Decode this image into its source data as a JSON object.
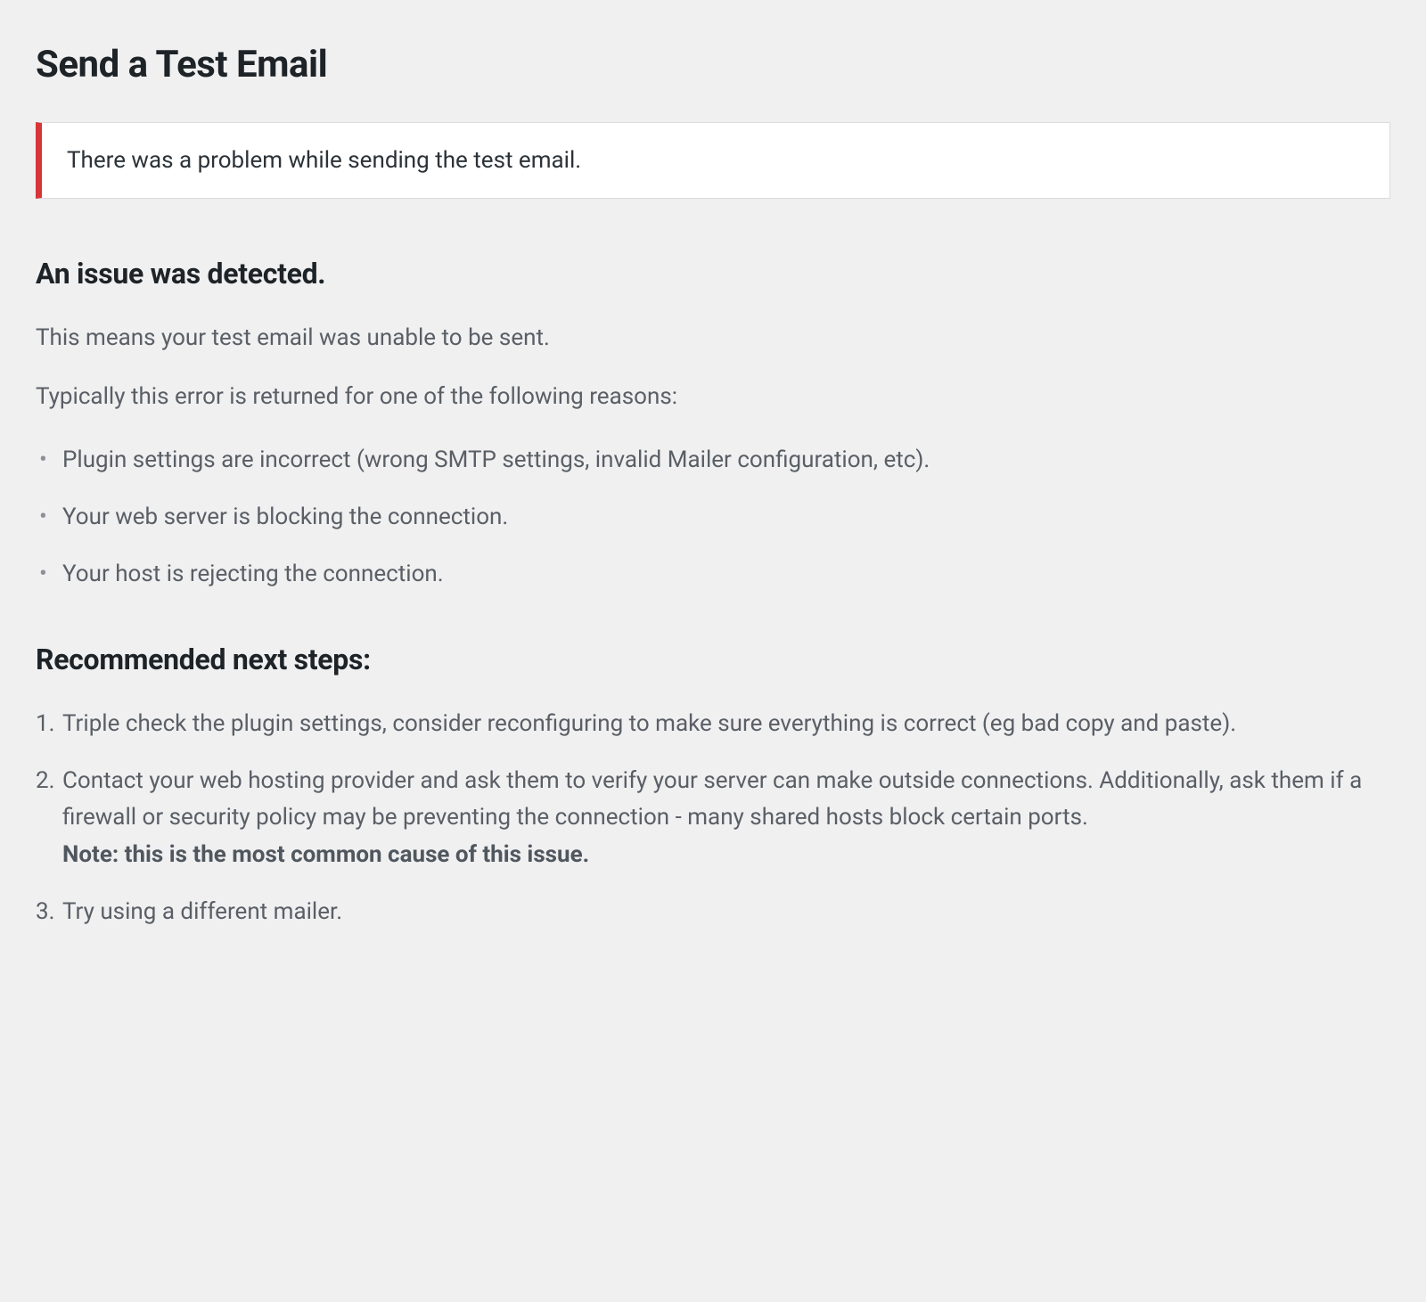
{
  "page": {
    "title": "Send a Test Email"
  },
  "error_banner": {
    "message": "There was a problem while sending the test email."
  },
  "issue": {
    "heading": "An issue was detected.",
    "intro": "This means your test email was unable to be sent.",
    "reasons_intro": "Typically this error is returned for one of the following reasons:",
    "reasons": [
      "Plugin settings are incorrect (wrong SMTP settings, invalid Mailer configuration, etc).",
      "Your web server is blocking the connection.",
      "Your host is rejecting the connection."
    ]
  },
  "next_steps": {
    "heading": "Recommended next steps:",
    "items": [
      {
        "text": "Triple check the plugin settings, consider reconfiguring to make sure everything is correct (eg bad copy and paste).",
        "note": ""
      },
      {
        "text": "Contact your web hosting provider and ask them to verify your server can make outside connections. Additionally, ask them if a firewall or security policy may be preventing the connection - many shared hosts block certain ports.",
        "note": "Note: this is the most common cause of this issue."
      },
      {
        "text": "Try using a different mailer.",
        "note": ""
      }
    ]
  },
  "colors": {
    "accent_red": "#d63638",
    "background": "#f0f0f1",
    "text_heading": "#1d2327",
    "text_body": "#5a5f66"
  }
}
